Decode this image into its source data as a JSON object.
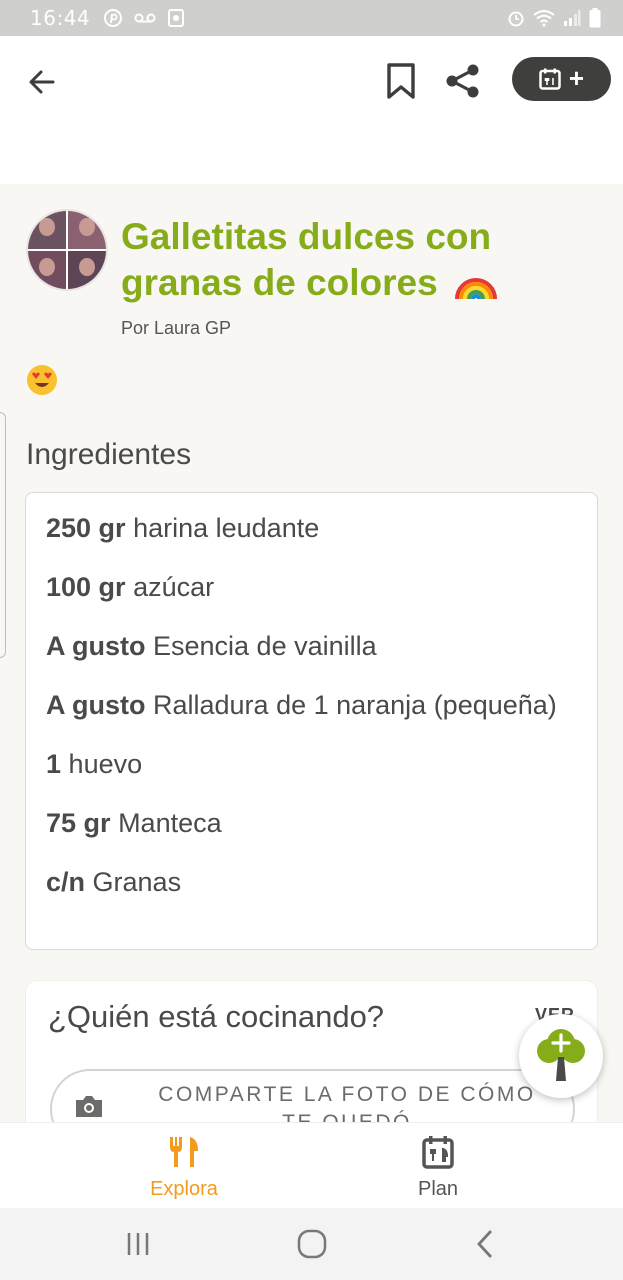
{
  "status_bar": {
    "time": "16:44",
    "left_icons": [
      "pinterest-icon",
      "voicemail-icon",
      "app-icon"
    ],
    "right_icons": [
      "alarm-icon",
      "wifi-icon",
      "signal-icon",
      "battery-icon"
    ]
  },
  "app_bar": {
    "icons": [
      "back-arrow-icon",
      "bookmark-icon",
      "share-icon",
      "calendar-icon"
    ],
    "plan_add_label": "+"
  },
  "recipe": {
    "title": "Galletitas dulces con granas de colores",
    "title_emoji": "rainbow",
    "author": "Por Laura GP",
    "description_emoji": "smiling-face-with-heart-eyes"
  },
  "ingredients": {
    "heading": "Ingredientes",
    "items": [
      {
        "qty": "250 gr",
        "name": "harina leudante"
      },
      {
        "qty": "100 gr",
        "name": "azúcar"
      },
      {
        "qty": "A gusto",
        "name": "Esencia de vainilla"
      },
      {
        "qty": "A gusto",
        "name": "Ralladura de 1 naranja (pequeña)"
      },
      {
        "qty": "1",
        "name": "huevo"
      },
      {
        "qty": "75 gr",
        "name": "Manteca"
      },
      {
        "qty": "c/n",
        "name": "Granas"
      }
    ]
  },
  "cooking": {
    "title": "¿Quién está cocinando?",
    "see_link": "VER",
    "share_photo_label": "COMPARTE LA FOTO DE CÓMO TE QUEDÓ"
  },
  "bottom_nav": {
    "items": [
      {
        "label": "Explora",
        "icon": "fork-knife-icon",
        "active": true
      },
      {
        "label": "Plan",
        "icon": "calendar-icon",
        "active": false
      }
    ]
  },
  "colors": {
    "title_green": "#86ac1a",
    "accent_orange": "#f29b1d",
    "dark_button": "#3f3f3e"
  }
}
